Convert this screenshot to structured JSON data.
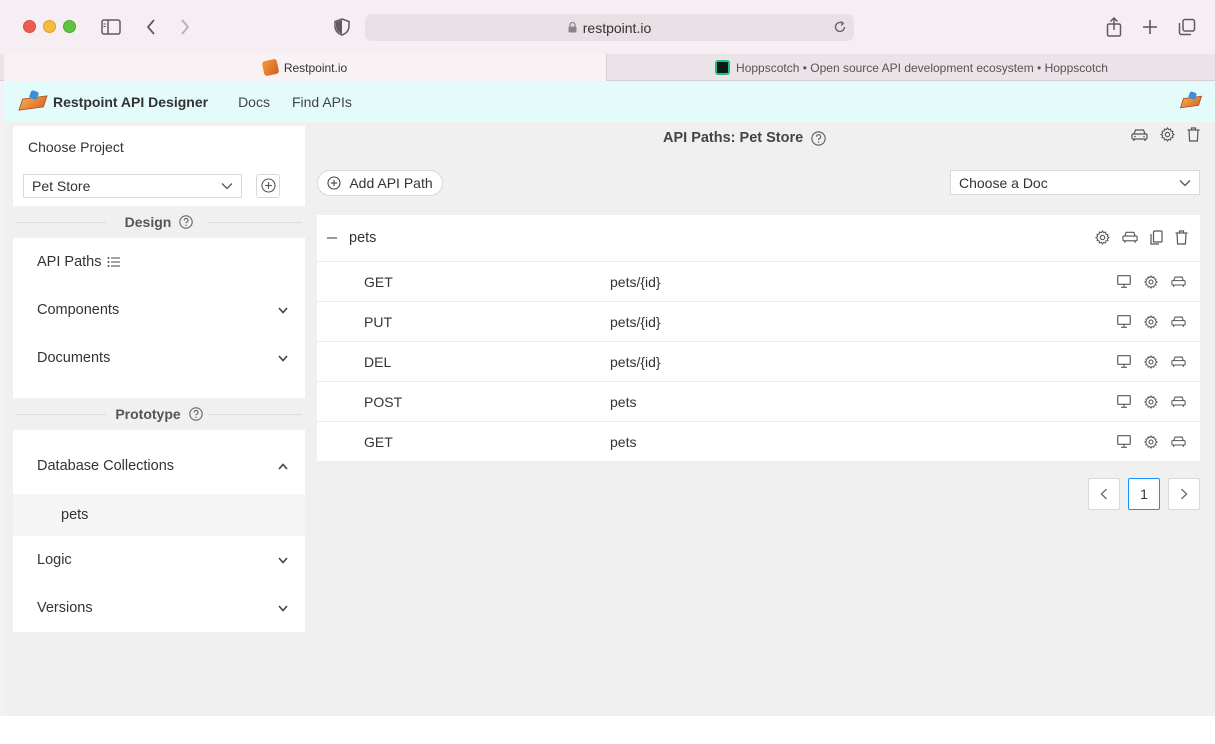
{
  "browser": {
    "url": "restpoint.io",
    "tabs": [
      {
        "title": "Restpoint.io",
        "active": true
      },
      {
        "title": "Hoppscotch • Open source API development ecosystem • Hoppscotch",
        "active": false
      }
    ]
  },
  "app": {
    "brand": "Restpoint API Designer",
    "nav": [
      "Docs",
      "Find APIs"
    ]
  },
  "sidebar": {
    "choose_project_label": "Choose Project",
    "project_value": "Pet Store",
    "design_heading": "Design",
    "design_items": [
      {
        "label": "API Paths"
      },
      {
        "label": "Components"
      },
      {
        "label": "Documents"
      }
    ],
    "prototype_heading": "Prototype",
    "prototype_items": [
      {
        "label": "Database Collections",
        "expanded": true,
        "children": [
          "pets"
        ]
      },
      {
        "label": "Logic"
      },
      {
        "label": "Versions"
      }
    ]
  },
  "main": {
    "title": "API Paths: Pet Store",
    "add_path_label": "Add API Path",
    "doc_select_placeholder": "Choose a Doc",
    "group": {
      "name": "pets",
      "rows": [
        {
          "method": "GET",
          "path": "pets/{id}"
        },
        {
          "method": "PUT",
          "path": "pets/{id}"
        },
        {
          "method": "DEL",
          "path": "pets/{id}"
        },
        {
          "method": "POST",
          "path": "pets"
        },
        {
          "method": "GET",
          "path": "pets"
        }
      ]
    },
    "pagination": {
      "current_page": "1"
    }
  },
  "colors": {
    "appbar_bg": "#e3fbfb",
    "accent": "#1890ff"
  }
}
